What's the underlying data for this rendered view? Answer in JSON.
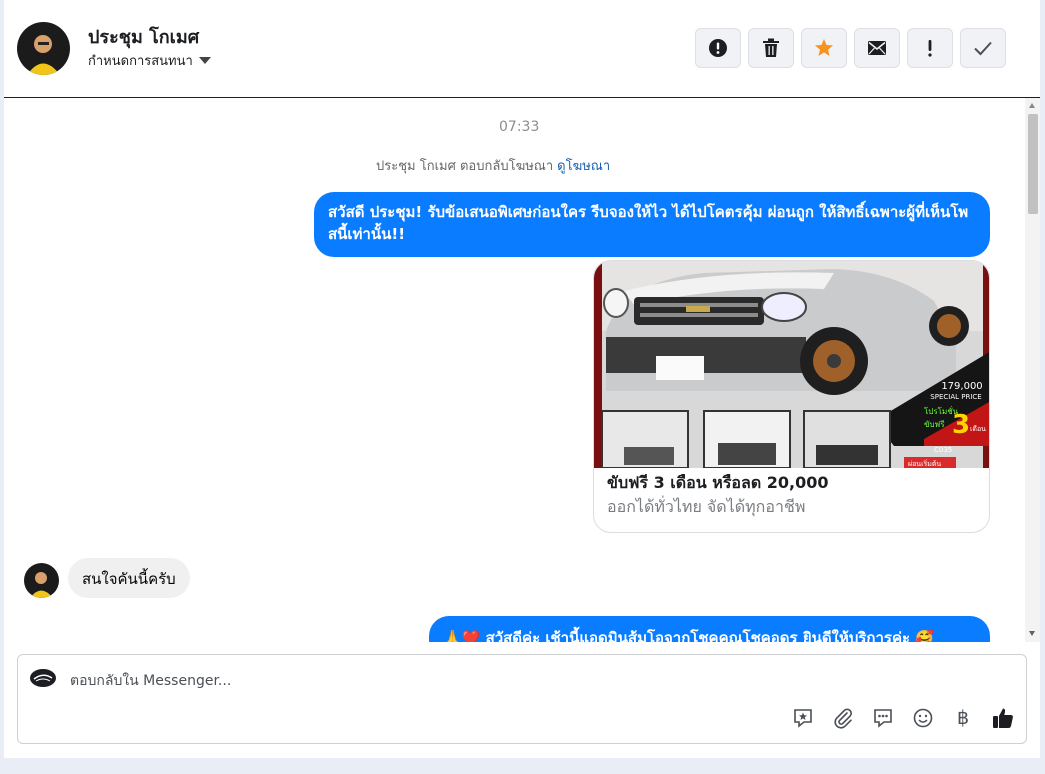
{
  "header": {
    "contact_name": "ประชุม โกเมศ",
    "assign_label": "กำหนดการสนทนา",
    "actions": [
      "report-icon",
      "trash-icon",
      "star-icon",
      "mail-icon",
      "exclamation-icon",
      "check-icon"
    ],
    "star_color": "#f7931e"
  },
  "chat": {
    "timestamp": "07:33",
    "ad_reply_text": "ประชุม โกเมศ ตอบกลับโฆษณา",
    "ad_reply_link": "ดูโฆษณา",
    "outgoing_1": "สวัสดี ประชุม! รับข้อเสนอพิเศษก่อนใคร รีบจองให้ไว ได้ไปโคตรคุ้ม ผ่อนถูก ให้สิทธิ์เฉพาะผู้ที่เห็นโพสนี้เท่านั้น!!",
    "ad_card": {
      "title": "ขับฟรี 3 เดือน หรือลด 20,000",
      "subtitle": "ออกได้ทั่วไทย จัดได้ทุกอาชีพ",
      "image_price": "179,000",
      "image_price_label": "SPECIAL PRICE",
      "image_promo": "โปรโมชั่น",
      "image_free": "ขับฟรี",
      "image_three": "3",
      "image_month": "เดือน",
      "image_code": "C035",
      "image_start": "ผ่อนเริ่มต้น"
    },
    "incoming_1": "สนใจคันนี้ครับ",
    "outgoing_2": "🙏❤️ สวัสดีค่ะ เช้านี้แอดมินส้มโอจากโชคคูณโชคอุดร ยินดีให้บริการค่ะ 🥰"
  },
  "composer": {
    "placeholder": "ตอบกลับใน Messenger...",
    "tools": [
      "saved-reply-icon",
      "attach-icon",
      "quick-reply-icon",
      "emoji-icon",
      "baht-icon",
      "like-icon"
    ],
    "baht_symbol": "฿"
  },
  "colors": {
    "accent": "#0a7cff",
    "incoming_bubble": "#f0f0f0"
  }
}
